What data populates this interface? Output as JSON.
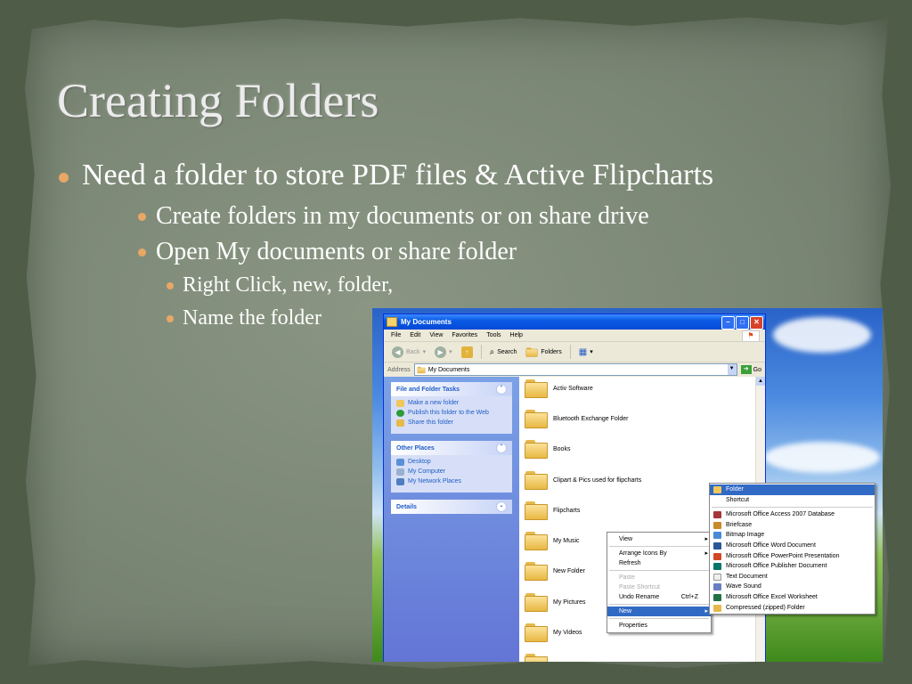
{
  "slide": {
    "title": "Creating Folders",
    "bullets": [
      "Need a folder to store PDF files & Active Flipcharts",
      "Create folders in my documents or on share drive",
      "Open My documents or share folder",
      "Right Click, new, folder,",
      "Name the folder"
    ],
    "bullet_color": "#e8a765"
  },
  "window": {
    "title": "My Documents",
    "menus": [
      "File",
      "Edit",
      "View",
      "Favorites",
      "Tools",
      "Help"
    ],
    "toolbar": {
      "back": "Back",
      "search": "Search",
      "folders": "Folders"
    },
    "address": {
      "label": "Address",
      "value": "My Documents",
      "go": "Go"
    },
    "tasks": {
      "title": "File and Folder Tasks",
      "links": [
        "Make a new folder",
        "Publish this folder to the Web",
        "Share this folder"
      ]
    },
    "other_places": {
      "title": "Other Places",
      "links": [
        "Desktop",
        "My Computer",
        "My Network Places"
      ]
    },
    "details": {
      "title": "Details"
    },
    "files": [
      "Activ Software",
      "Bluetooth Exchange Folder",
      "Books",
      "Clipart & Pics used for flipcharts",
      "Flipcharts",
      "My Music",
      "New Folder",
      "My Pictures",
      "My Videos"
    ]
  },
  "context_menu": {
    "view": "View",
    "arrange": "Arrange Icons By",
    "refresh": "Refresh",
    "paste": "Paste",
    "paste_shortcut": "Paste Shortcut",
    "undo": "Undo Rename",
    "undo_shortcut": "Ctrl+Z",
    "new": "New",
    "properties": "Properties"
  },
  "new_menu": {
    "items": [
      "Folder",
      "Shortcut",
      "Microsoft Office Access 2007 Database",
      "Briefcase",
      "Bitmap Image",
      "Microsoft Office Word Document",
      "Microsoft Office PowerPoint Presentation",
      "Microsoft Office Publisher Document",
      "Text Document",
      "Wave Sound",
      "Microsoft Office Excel Worksheet",
      "Compressed (zipped) Folder"
    ],
    "icon_colors": [
      "#f1c75a",
      "#ffffff",
      "#a4373a",
      "#c98a2a",
      "#4a8ad8",
      "#2b579a",
      "#d24726",
      "#077568",
      "#eeeeee",
      "#6a7fc2",
      "#217346",
      "#e6b94a"
    ]
  }
}
